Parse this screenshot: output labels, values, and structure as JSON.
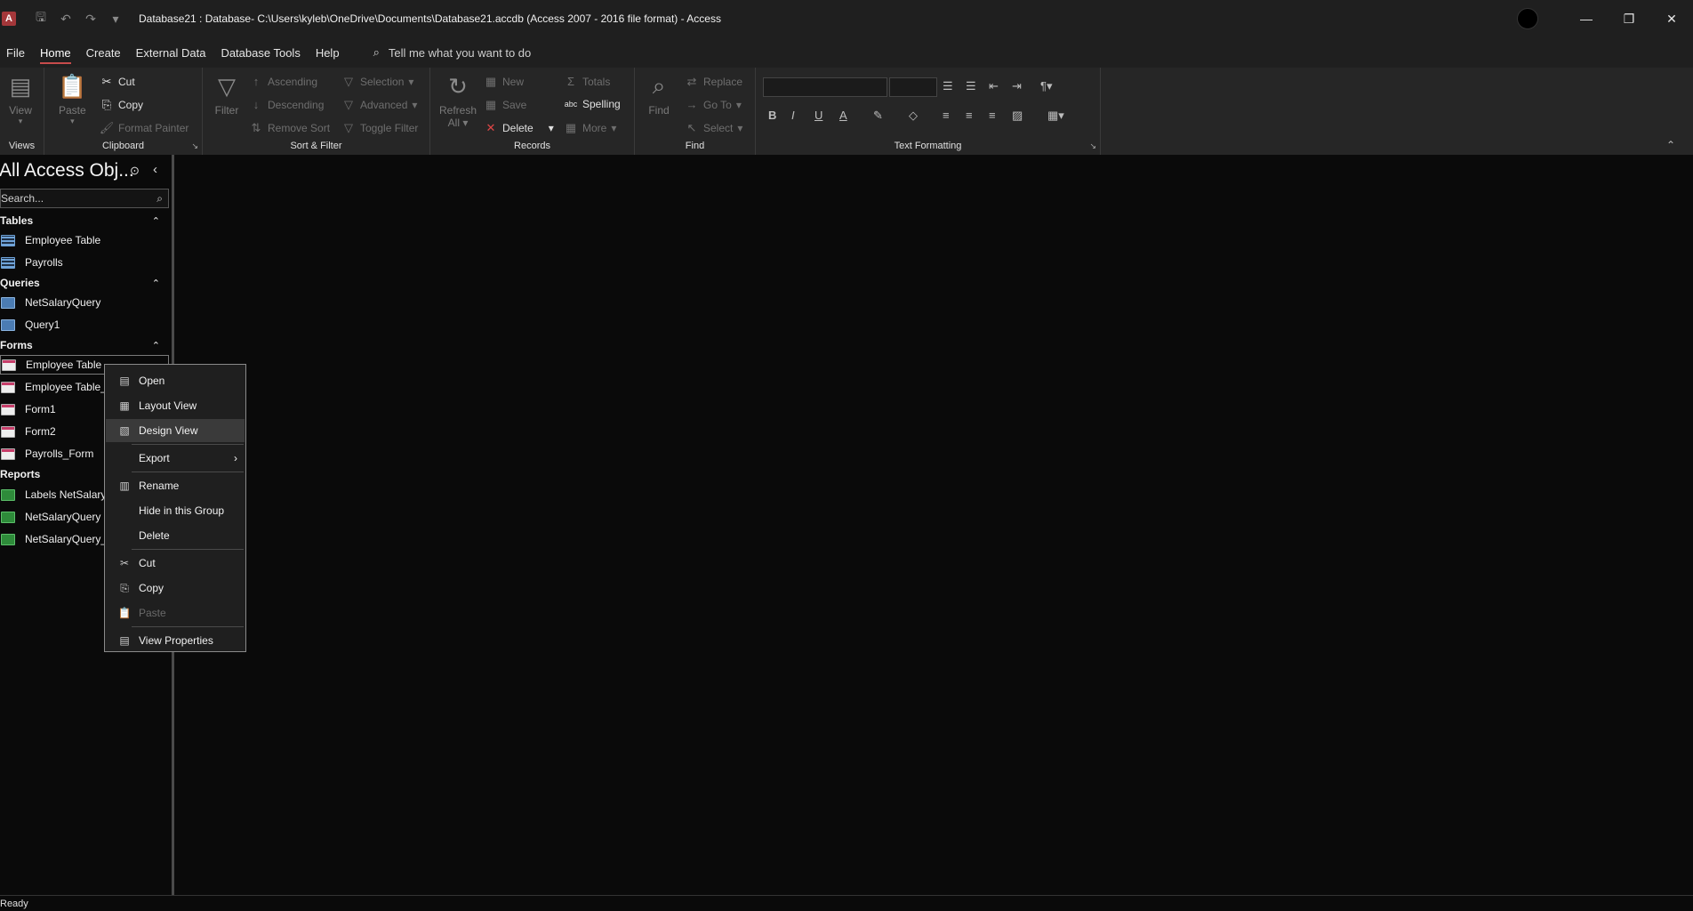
{
  "app": {
    "icon_letter": "A",
    "title": "Database21 : Database- C:\\Users\\kyleb\\OneDrive\\Documents\\Database21.accdb (Access 2007 - 2016 file format)  -  Access",
    "accent_color": "#a4373a"
  },
  "menu": {
    "tabs": [
      "File",
      "Home",
      "Create",
      "External Data",
      "Database Tools",
      "Help"
    ],
    "active": "Home",
    "tellme": "Tell me what you want to do"
  },
  "ribbon": {
    "views": {
      "view": "View",
      "label": "Views"
    },
    "clipboard": {
      "paste": "Paste",
      "cut": "Cut",
      "copy": "Copy",
      "format_painter": "Format Painter",
      "label": "Clipboard"
    },
    "sort_filter": {
      "filter": "Filter",
      "ascending": "Ascending",
      "descending": "Descending",
      "remove_sort": "Remove Sort",
      "selection": "Selection",
      "advanced": "Advanced",
      "toggle_filter": "Toggle Filter",
      "label": "Sort & Filter"
    },
    "records": {
      "refresh": "Refresh",
      "refresh_all": "All",
      "new": "New",
      "save": "Save",
      "delete": "Delete",
      "totals": "Totals",
      "spelling": "Spelling",
      "more": "More",
      "label": "Records"
    },
    "find": {
      "find": "Find",
      "replace": "Replace",
      "goto": "Go To",
      "select": "Select",
      "label": "Find"
    },
    "text_formatting": {
      "bold": "B",
      "italic": "I",
      "underline": "U",
      "font_color": "A",
      "label": "Text Formatting"
    }
  },
  "nav": {
    "title": "All Access Obj...",
    "search_placeholder": "Search...",
    "groups": {
      "tables": {
        "label": "Tables",
        "items": [
          "Employee Table",
          "Payrolls"
        ]
      },
      "queries": {
        "label": "Queries",
        "items": [
          "NetSalaryQuery",
          "Query1"
        ]
      },
      "forms": {
        "label": "Forms",
        "items": [
          "Employee Table",
          "Employee Table_",
          "Form1",
          "Form2",
          "Payrolls_Form"
        ]
      },
      "reports": {
        "label": "Reports",
        "items": [
          "Labels NetSalaryQ",
          "NetSalaryQuery",
          "NetSalaryQuery_"
        ]
      }
    }
  },
  "context_menu": {
    "open": "Open",
    "layout_view": "Layout View",
    "design_view": "Design View",
    "export": "Export",
    "rename": "Rename",
    "hide_in_group": "Hide in this Group",
    "delete": "Delete",
    "cut": "Cut",
    "copy": "Copy",
    "paste": "Paste",
    "view_properties": "View Properties"
  },
  "status": {
    "text": "Ready"
  }
}
